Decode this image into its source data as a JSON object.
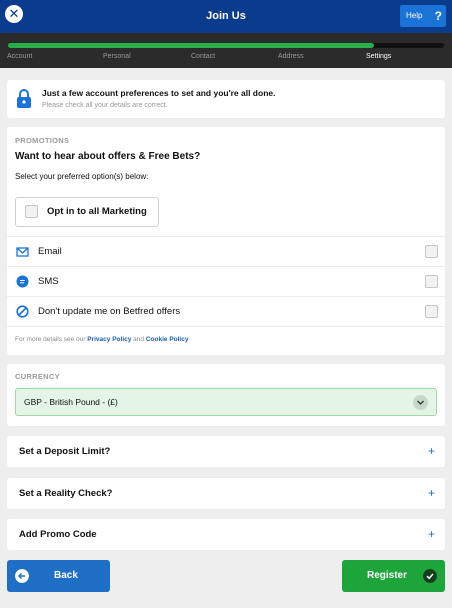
{
  "header": {
    "title": "Join Us",
    "help_label": "Help",
    "help_symbol": "?",
    "close_symbol": "✕"
  },
  "progress": {
    "fraction": 0.84,
    "steps": [
      "Account",
      "Personal",
      "Contact",
      "Address",
      "Settings"
    ],
    "active_step": "Settings"
  },
  "info": {
    "title": "Just a few account preferences to set and you're all done.",
    "subtitle": "Please check all your details are correct."
  },
  "promotions": {
    "section_label": "PROMOTIONS",
    "question": "Want to hear about offers & Free Bets?",
    "select_text": "Select your preferred option(s) below:",
    "optin_label": "Opt in to all Marketing",
    "options": [
      {
        "icon": "envelope-icon",
        "label": "Email"
      },
      {
        "icon": "chat-bubble-icon",
        "label": "SMS"
      },
      {
        "icon": "no-entry-icon",
        "label": "Don't update me on Betfred offers"
      }
    ],
    "policy_prefix": "For more details see our",
    "privacy_link": "Privacy Policy",
    "and_text": "and",
    "cookie_link": "Cookie Policy"
  },
  "currency": {
    "section_label": "CURRENCY",
    "value": "GBP - British Pound - (£)"
  },
  "expanders": [
    {
      "label": "Set a Deposit Limit?",
      "symbol": "+"
    },
    {
      "label": "Set a Reality Check?",
      "symbol": "+"
    },
    {
      "label": "Add Promo Code",
      "symbol": "+"
    }
  ],
  "buttons": {
    "back": "Back",
    "register": "Register"
  },
  "colors": {
    "brand": "#0b3b8c",
    "accent": "#1a73d6",
    "success": "#1da53b",
    "progress": "#27b04a"
  }
}
